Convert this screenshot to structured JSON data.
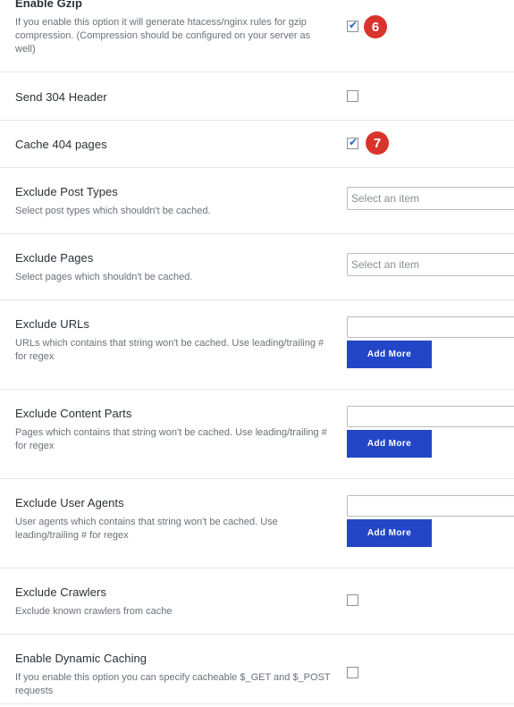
{
  "settings": [
    {
      "title": "Enable Gzip",
      "description": "If you enable this option it will generate htacess/nginx rules for gzip compression. (Compression should be configured on your server as well)",
      "checked": true,
      "badge": "6"
    },
    {
      "title": "Send 304 Header",
      "checked": false
    },
    {
      "title": "Cache 404 pages",
      "checked": true,
      "badge": "7"
    },
    {
      "title": "Exclude Post Types",
      "description": "Select post types which shouldn't be cached.",
      "placeholder": "Select an item"
    },
    {
      "title": "Exclude Pages",
      "description": "Select pages which shouldn't be cached.",
      "placeholder": "Select an item"
    },
    {
      "title": "Exclude URLs",
      "description": "URLs which contains that string won't be cached. Use leading/trailing # for regex",
      "button": "Add More"
    },
    {
      "title": "Exclude Content Parts",
      "description": "Pages which contains that string won't be cached. Use leading/trailing # for regex",
      "button": "Add More"
    },
    {
      "title": "Exclude User Agents",
      "description": "User agents which contains that string won't be cached. Use leading/trailing # for regex",
      "button": "Add More"
    },
    {
      "title": "Exclude Crawlers",
      "description": "Exclude known crawlers from cache",
      "checked": false
    },
    {
      "title": "Enable Dynamic Caching",
      "description": "If you enable this option you can specify cacheable $_GET and $_POST requests",
      "checked": false
    }
  ],
  "icons": {
    "check": "check-icon"
  },
  "colors": {
    "badge": "#d9342b",
    "button": "#2346c7",
    "check": "#2a66b8"
  }
}
